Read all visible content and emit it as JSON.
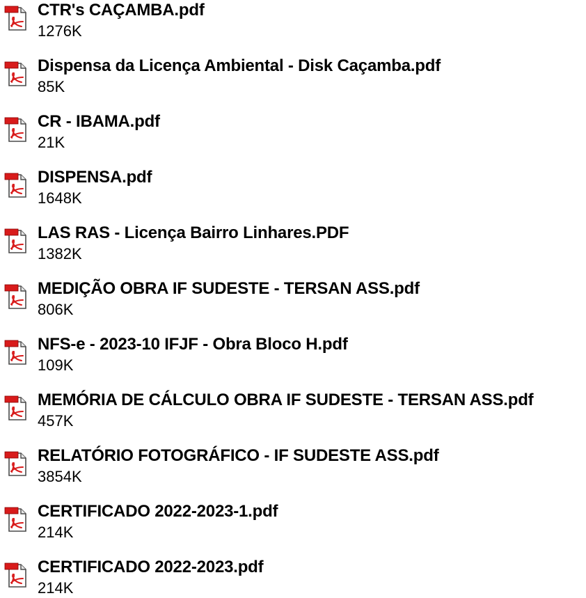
{
  "attachments": [
    {
      "name": "CTR's CAÇAMBA.pdf",
      "size": "1276K",
      "icon": "pdf-file-icon"
    },
    {
      "name": "Dispensa da Licença Ambiental - Disk Caçamba.pdf",
      "size": "85K",
      "icon": "pdf-file-icon"
    },
    {
      "name": "CR - IBAMA.pdf",
      "size": "21K",
      "icon": "pdf-file-icon"
    },
    {
      "name": "DISPENSA.pdf",
      "size": "1648K",
      "icon": "pdf-file-icon"
    },
    {
      "name": "LAS RAS - Licença Bairro Linhares.PDF",
      "size": "1382K",
      "icon": "pdf-file-icon"
    },
    {
      "name": "MEDIÇÃO OBRA IF SUDESTE - TERSAN ASS.pdf",
      "size": "806K",
      "icon": "pdf-file-icon"
    },
    {
      "name": "NFS-e - 2023-10 IFJF - Obra Bloco H.pdf",
      "size": "109K",
      "icon": "pdf-file-icon"
    },
    {
      "name": "MEMÓRIA DE CÁLCULO OBRA IF SUDESTE - TERSAN ASS.pdf",
      "size": "457K",
      "icon": "pdf-file-icon"
    },
    {
      "name": "RELATÓRIO FOTOGRÁFICO - IF SUDESTE ASS.pdf",
      "size": "3854K",
      "icon": "pdf-file-icon"
    },
    {
      "name": "CERTIFICADO 2022-2023-1.pdf",
      "size": "214K",
      "icon": "pdf-file-icon"
    },
    {
      "name": "CERTIFICADO 2022-2023.pdf",
      "size": "214K",
      "icon": "pdf-file-icon"
    }
  ],
  "colors": {
    "text": "#000000",
    "icon_red": "#d81b1b",
    "icon_page": "#ffffff",
    "icon_outline": "#4a4a4a"
  }
}
